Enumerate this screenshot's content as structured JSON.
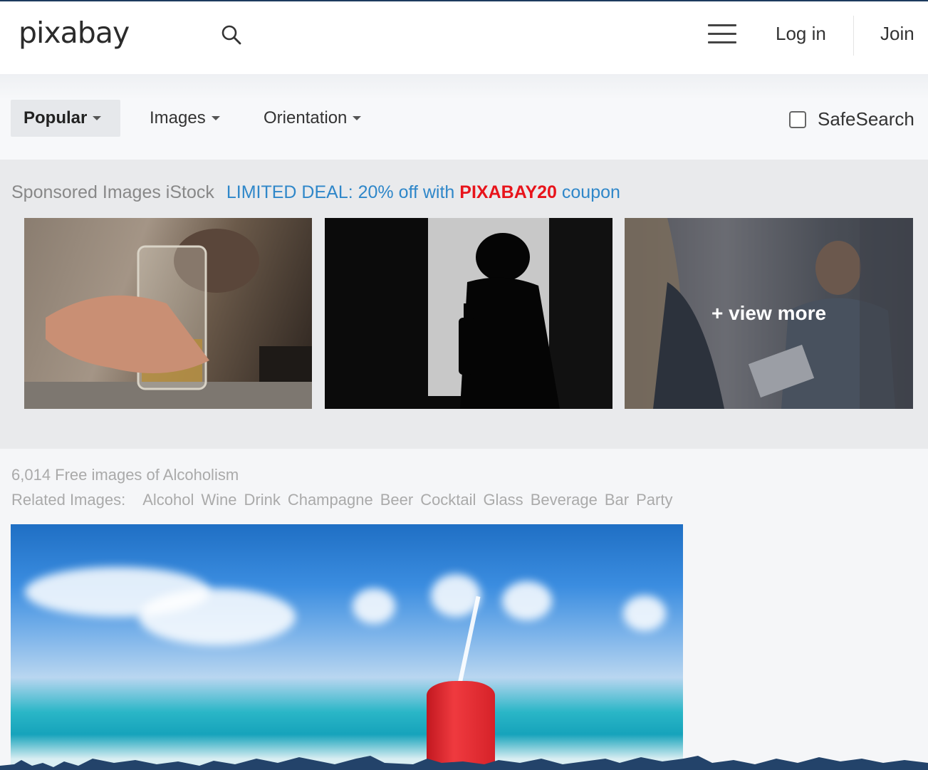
{
  "header": {
    "logo": "pixabay",
    "login_label": "Log in",
    "join_label": "Join"
  },
  "filters": {
    "popular": "Popular",
    "images": "Images",
    "orientation": "Orientation",
    "safesearch": "SafeSearch",
    "safesearch_checked": false
  },
  "sponsored": {
    "label": "Sponsored Images iStock",
    "deal_prefix": "LIMITED DEAL: 20% off with",
    "deal_code": "PIXABAY20",
    "deal_suffix": "coupon",
    "view_more": "+ view more"
  },
  "results": {
    "count_text": "6,014 Free images of Alcoholism",
    "related_label": "Related Images:",
    "related_tags": [
      "Alcohol",
      "Wine",
      "Drink",
      "Champagne",
      "Beer",
      "Cocktail",
      "Glass",
      "Beverage",
      "Bar",
      "Party"
    ]
  },
  "colors": {
    "deal_blue": "#2f87c9",
    "coupon_red": "#e8141b",
    "header_border": "#1c3a5e"
  }
}
